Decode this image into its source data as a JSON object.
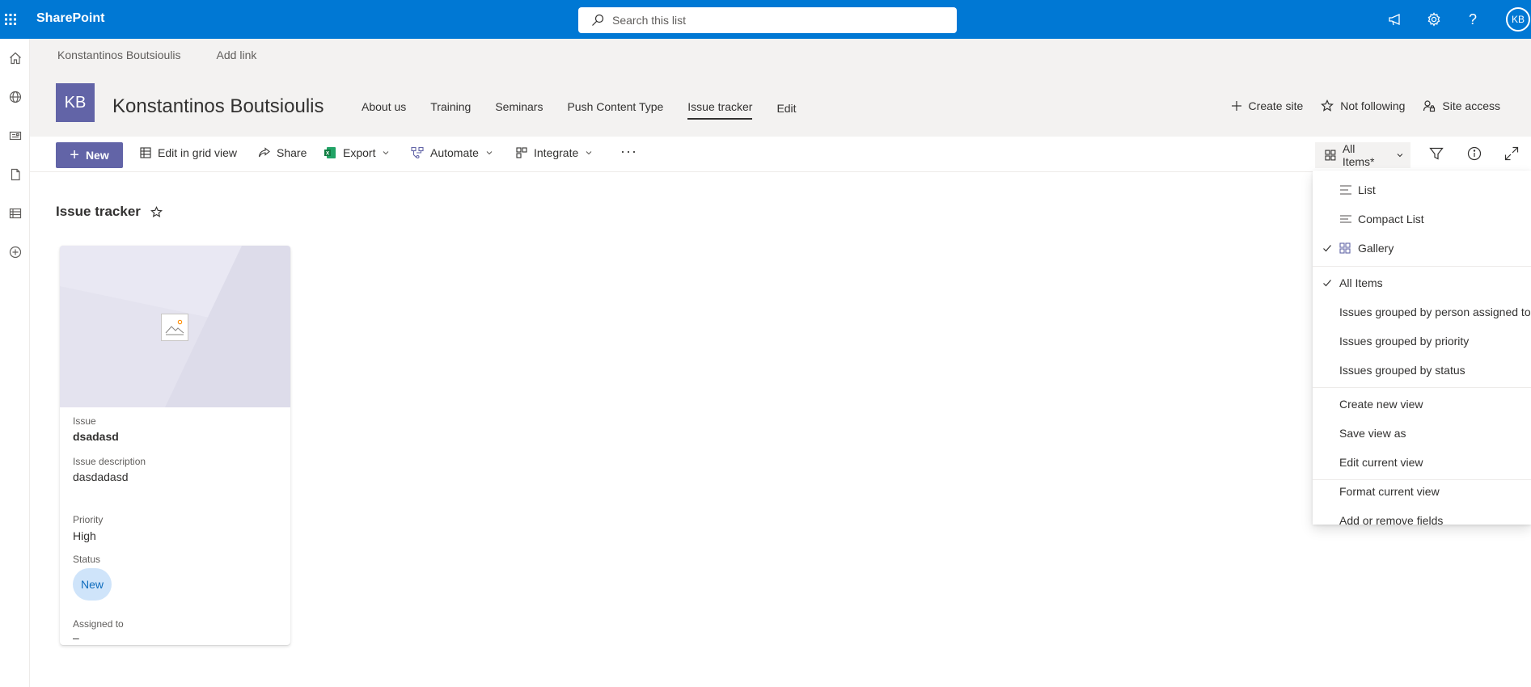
{
  "suite": {
    "brand": "SharePoint",
    "search_placeholder": "Search this list",
    "avatar_initials": "KB"
  },
  "hub": {
    "items": [
      "Konstantinos Boutsioulis",
      "Add link"
    ]
  },
  "site": {
    "logo": "KB",
    "title": "Konstantinos Boutsioulis",
    "nav": [
      "About us",
      "Training",
      "Seminars",
      "Push Content Type",
      "Issue tracker",
      "Edit"
    ],
    "active_nav": "Issue tracker",
    "actions": [
      "Create site",
      "Not following",
      "Site access"
    ]
  },
  "commands": {
    "new": "New",
    "edit_grid": "Edit in grid view",
    "share": "Share",
    "export": "Export",
    "automate": "Automate",
    "integrate": "Integrate",
    "view_selector": "All Items*"
  },
  "list": {
    "title": "Issue tracker"
  },
  "card": {
    "fields": [
      {
        "label": "Issue",
        "value": "dsadasd"
      },
      {
        "label": "Issue description",
        "value": "dasdadasd"
      },
      {
        "label": "Priority",
        "value": "High"
      },
      {
        "label": "Status",
        "value": "New"
      },
      {
        "label": "Assigned to",
        "value": "–"
      }
    ]
  },
  "view_menu": {
    "layouts": [
      "List",
      "Compact List",
      "Gallery"
    ],
    "selected_layout": "Gallery",
    "views": [
      "All Items",
      "Issues grouped by person assigned to",
      "Issues grouped by priority",
      "Issues grouped by status"
    ],
    "selected_view": "All Items",
    "manage": [
      "Create new view",
      "Save view as",
      "Edit current view"
    ],
    "format": [
      "Format current view",
      "Add or remove fields"
    ]
  },
  "colors": {
    "suite_blue": "#0078d4",
    "theme_purple": "#6264a7",
    "highlight_yellow": "#f7f700",
    "status_pill_bg": "#cfe4fa"
  }
}
